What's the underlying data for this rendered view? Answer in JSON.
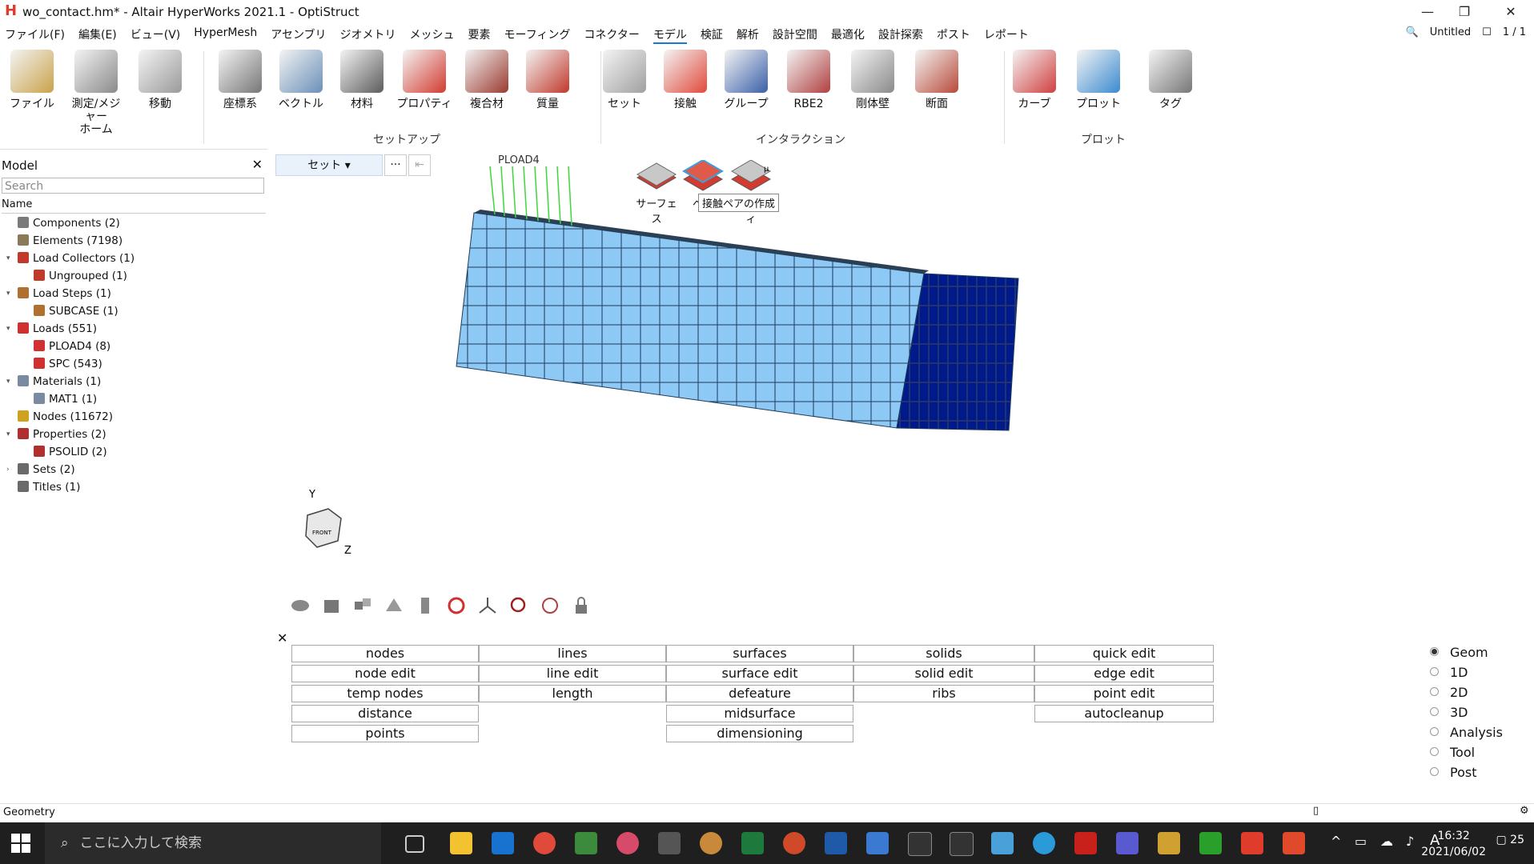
{
  "window": {
    "title": "wo_contact.hm* - Altair HyperWorks 2021.1 - OptiStruct",
    "controls": [
      "—",
      "❐",
      "✕"
    ]
  },
  "menu": {
    "items": [
      "ファイル(F)",
      "編集(E)",
      "ビュー(V)",
      "HyperMesh",
      "アセンブリ",
      "ジオメトリ",
      "メッシュ",
      "要素",
      "モーフィング",
      "コネクター",
      "モデル",
      "検証",
      "解析",
      "設計空間",
      "最適化",
      "設計探索",
      "ポスト",
      "レポート"
    ],
    "active": "モデル",
    "session": "Untitled",
    "pages": "1 / 1"
  },
  "ribbon": {
    "tools": [
      {
        "label": "ファイル",
        "color": "#c9a24a"
      },
      {
        "label": "測定/メジャー\nホーム",
        "color": "#8a8a8a"
      },
      {
        "label": "移動",
        "color": "#9a9a9a"
      },
      {
        "label": "座標系",
        "color": "#777777"
      },
      {
        "label": "ベクトル",
        "color": "#6a8fb8"
      },
      {
        "label": "材料",
        "color": "#5c5c5c"
      },
      {
        "label": "プロパティ",
        "color": "#d23b2f"
      },
      {
        "label": "複合材",
        "color": "#9a3a2f"
      },
      {
        "label": "質量",
        "color": "#c0392b"
      },
      {
        "label": "セット",
        "color": "#a0a0a0"
      },
      {
        "label": "接触",
        "color": "#e04a3a"
      },
      {
        "label": "グループ",
        "color": "#3a5fa8"
      },
      {
        "label": "RBE2",
        "color": "#b04040"
      },
      {
        "label": "剛体壁",
        "color": "#8a8a8a"
      },
      {
        "label": "断面",
        "color": "#b84a3a"
      },
      {
        "label": "カーブ",
        "color": "#d04040"
      },
      {
        "label": "プロット",
        "color": "#3a8ad0"
      },
      {
        "label": "タグ",
        "color": "#777777"
      }
    ],
    "groups": [
      "セットアップ",
      "インタラクション",
      "プロット"
    ]
  },
  "model_browser": {
    "title": "Model",
    "search_placeholder": "Search",
    "column": "Name",
    "items": [
      {
        "label": "Components  (2)",
        "level": 0,
        "expand": "",
        "color": "#7a7a7a"
      },
      {
        "label": "Elements  (7198)",
        "level": 0,
        "expand": "",
        "color": "#8a7a5a"
      },
      {
        "label": "Load Collectors  (1)",
        "level": 0,
        "expand": "▾",
        "color": "#c0392b"
      },
      {
        "label": "Ungrouped  (1)",
        "level": 1,
        "expand": "",
        "color": "#c0392b"
      },
      {
        "label": "Load Steps  (1)",
        "level": 0,
        "expand": "▾",
        "color": "#b07030"
      },
      {
        "label": "SUBCASE  (1)",
        "level": 1,
        "expand": "",
        "color": "#b07030"
      },
      {
        "label": "Loads  (551)",
        "level": 0,
        "expand": "▾",
        "color": "#d03030"
      },
      {
        "label": "PLOAD4  (8)",
        "level": 1,
        "expand": "",
        "color": "#d03030"
      },
      {
        "label": "SPC  (543)",
        "level": 1,
        "expand": "",
        "color": "#d03030"
      },
      {
        "label": "Materials  (1)",
        "level": 0,
        "expand": "▾",
        "color": "#7a8aa0"
      },
      {
        "label": "MAT1  (1)",
        "level": 1,
        "expand": "",
        "color": "#7a8aa0"
      },
      {
        "label": "Nodes  (11672)",
        "level": 0,
        "expand": "",
        "color": "#d0a020"
      },
      {
        "label": "Properties  (2)",
        "level": 0,
        "expand": "▾",
        "color": "#b03030"
      },
      {
        "label": "PSOLID  (2)",
        "level": 1,
        "expand": "",
        "color": "#b03030"
      },
      {
        "label": "Sets  (2)",
        "level": 0,
        "expand": "›",
        "color": "#6a6a6a"
      },
      {
        "label": "Titles  (1)",
        "level": 0,
        "expand": "",
        "color": "#6a6a6a"
      }
    ]
  },
  "viewport": {
    "set_button": "セット",
    "more": "···",
    "tooltip": "接触ペアの作成",
    "popup_items": [
      "サーフェス",
      "ペア",
      "プロパティ"
    ],
    "load_label": "PLOAD4",
    "axis_y": "Y",
    "axis_z": "Z",
    "cube_label": "FRONT"
  },
  "panel": {
    "close": "✕",
    "columns": [
      [
        "nodes",
        "node edit",
        "temp nodes",
        "distance",
        "points"
      ],
      [
        "lines",
        "line edit",
        "length"
      ],
      [
        "surfaces",
        "surface edit",
        "defeature",
        "midsurface",
        "dimensioning"
      ],
      [
        "solids",
        "solid edit",
        "ribs"
      ],
      [
        "quick edit",
        "edge edit",
        "point edit",
        "autocleanup"
      ]
    ],
    "radios": [
      "Geom",
      "1D",
      "2D",
      "3D",
      "Analysis",
      "Tool",
      "Post"
    ],
    "selected_radio": "Geom"
  },
  "status": {
    "text": "Geometry"
  },
  "taskbar": {
    "search_placeholder": "ここに入力して検索",
    "time": "16:32",
    "date": "2021/06/02",
    "notifications": "25",
    "ime": "A"
  }
}
